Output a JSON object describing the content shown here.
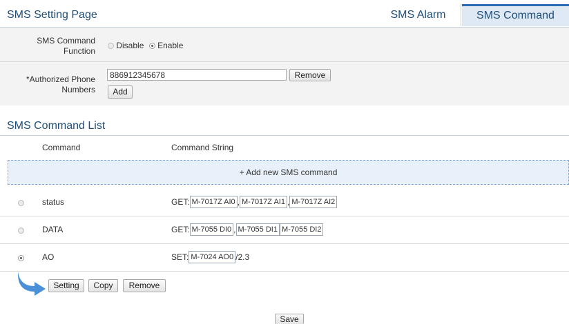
{
  "header": {
    "title": "SMS Setting Page",
    "tabs": [
      {
        "label": "SMS Alarm",
        "active": false
      },
      {
        "label": "SMS Command",
        "active": true
      }
    ]
  },
  "settings": {
    "command_function": {
      "label_line1": "SMS Command",
      "label_line2": "Function",
      "options": [
        {
          "label": "Disable",
          "selected": false
        },
        {
          "label": "Enable",
          "selected": true
        }
      ]
    },
    "authorized_numbers": {
      "label_line1": "*Authorized Phone",
      "label_line2": "Numbers",
      "value": "886912345678",
      "remove_label": "Remove",
      "add_label": "Add"
    }
  },
  "command_list": {
    "title": "SMS Command List",
    "columns": [
      "Command",
      "Command String"
    ],
    "add_new_label": "+ Add new SMS command",
    "rows": [
      {
        "command": "status",
        "prefix": "GET:",
        "selected": false,
        "parts": [
          "M-7017Z AI0",
          ",",
          "M-7017Z AI1",
          ",",
          "M-7017Z AI2"
        ]
      },
      {
        "command": "DATA",
        "prefix": "GET:",
        "selected": false,
        "parts": [
          "M-7055 DI0",
          ",",
          "M-7055 DI1",
          "",
          "M-7055 DI2"
        ]
      },
      {
        "command": "AO",
        "prefix": "SET:",
        "selected": true,
        "parts": [
          "M-7024 AO0",
          "/2.3"
        ]
      }
    ],
    "actions": {
      "setting": "Setting",
      "copy": "Copy",
      "remove": "Remove"
    }
  },
  "footer": {
    "save_label": "Save"
  },
  "colors": {
    "title_blue": "#1f4e79",
    "tab_active_bg": "#dfe9f5",
    "add_row_bg": "#e8f1fa",
    "arrow_blue": "#4a90d9"
  }
}
